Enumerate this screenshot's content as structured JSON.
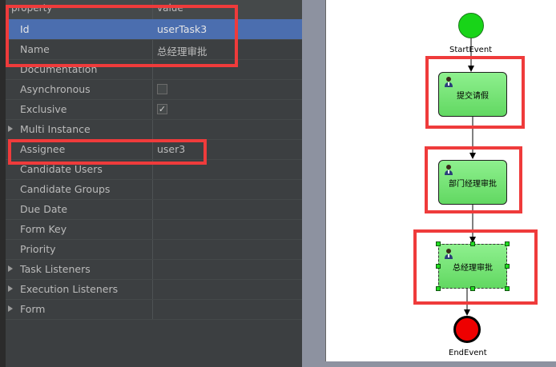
{
  "properties": {
    "header": {
      "property": "property",
      "value": "value"
    },
    "rows": [
      {
        "name": "Id",
        "value": "userTask3"
      },
      {
        "name": "Name",
        "value": "总经理审批"
      },
      {
        "name": "Documentation",
        "value": ""
      },
      {
        "name": "Asynchronous",
        "checked": false
      },
      {
        "name": "Exclusive",
        "checked": true
      },
      {
        "name": "Multi Instance",
        "value": ""
      },
      {
        "name": "Assignee",
        "value": "user3"
      },
      {
        "name": "Candidate Users",
        "value": ""
      },
      {
        "name": "Candidate Groups",
        "value": ""
      },
      {
        "name": "Due Date",
        "value": ""
      },
      {
        "name": "Form Key",
        "value": ""
      },
      {
        "name": "Priority",
        "value": ""
      },
      {
        "name": "Task Listeners",
        "value": ""
      },
      {
        "name": "Execution Listeners",
        "value": ""
      },
      {
        "name": "Form",
        "value": ""
      }
    ],
    "check_mark": "✓"
  },
  "diagram": {
    "start_label": "StartEvent",
    "end_label": "EndEvent",
    "tasks": [
      {
        "label": "提交请假"
      },
      {
        "label": "部门经理审批"
      },
      {
        "label": "总经理审批"
      }
    ]
  },
  "colors": {
    "highlight": "#ef3b3b",
    "selected_row": "#4b6eaf",
    "task_fill": "#7ee37e",
    "start_event": "#18d418",
    "end_event": "#ee0000"
  }
}
